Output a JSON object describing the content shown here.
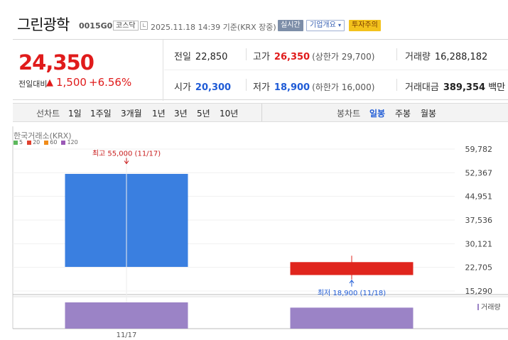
{
  "header": {
    "name": "그린광학",
    "code": "0015G0",
    "market_tag": "코스닥",
    "time": "2025.11.18 14:39 기준(KRX 장중)",
    "realtime_btn": "실시간",
    "company_btn": "기업개요",
    "warning_btn": "투자주의"
  },
  "summary": {
    "price": "24,350",
    "change_label": "전일대비",
    "change_arrow": "▲",
    "change_value": "1,500",
    "change_pct": "+6.56%",
    "prev_close_label": "전일",
    "prev_close": "22,850",
    "high_label": "고가",
    "high": "26,350",
    "upper_limit": "(상한가 29,700)",
    "volume_label": "거래량",
    "volume": "16,288,182",
    "open_label": "시가",
    "open": "20,300",
    "low_label": "저가",
    "low": "18,900",
    "lower_limit": "(하한가 16,000)",
    "amount_label": "거래대금",
    "amount": "389,354",
    "amount_unit": "백만"
  },
  "tabs": {
    "line_label": "선차트",
    "line_tabs": [
      "1일",
      "1주일",
      "3개월",
      "1년",
      "3년",
      "5년",
      "10년"
    ],
    "candle_label": "봉차트",
    "candle_tabs": [
      "일봉",
      "주봉",
      "월봉"
    ],
    "active_candle": "일봉"
  },
  "chart": {
    "market_label": "한국거래소(KRX)",
    "ma_legend": [
      {
        "label": "5",
        "color": "#5cb85c"
      },
      {
        "label": "20",
        "color": "#e0412f"
      },
      {
        "label": "60",
        "color": "#f08c1a"
      },
      {
        "label": "120",
        "color": "#9b59b6"
      }
    ],
    "high_annotation": "최고 55,000 (11/17)",
    "low_annotation": "최저 18,900 (11/18)",
    "volume_legend": "거래량",
    "up_color": "#e0251d",
    "down_color": "#3a7fe0",
    "volume_color": "#9b83c6"
  },
  "chart_data": {
    "type": "candlestick",
    "y_ticks": [
      "59,782",
      "52,367",
      "44,951",
      "37,536",
      "30,121",
      "22,705",
      "15,290"
    ],
    "x_ticks": [
      "11/17"
    ],
    "ylim": [
      15290,
      59782
    ],
    "candles": [
      {
        "date": "11/17",
        "open": 52000,
        "close": 22850,
        "high": 55000,
        "low": 22850
      },
      {
        "date": "11/18",
        "open": 20300,
        "close": 24350,
        "high": 26350,
        "low": 18900
      }
    ],
    "volume": [
      {
        "date": "11/17",
        "value": 1.0
      },
      {
        "date": "11/18",
        "value": 0.8
      }
    ]
  }
}
